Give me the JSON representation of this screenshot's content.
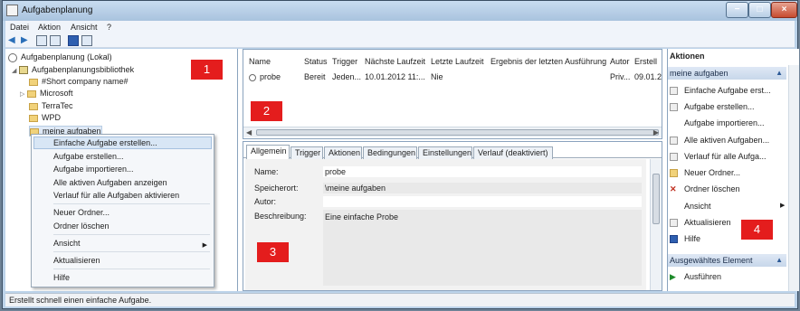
{
  "window": {
    "title": "Aufgabenplanung"
  },
  "menu": [
    "Datei",
    "Aktion",
    "Ansicht",
    "?"
  ],
  "tree": {
    "root": "Aufgabenplanung (Lokal)",
    "library": "Aufgabenplanungsbibliothek",
    "folders": [
      "#Short company name#",
      "Microsoft",
      "TerraTec",
      "WPD",
      "meine aufgaben"
    ]
  },
  "context_menu": {
    "items": [
      "Einfache Aufgabe erstellen...",
      "Aufgabe erstellen...",
      "Aufgabe importieren...",
      "Alle aktiven Aufgaben anzeigen",
      "Verlauf für alle Aufgaben aktivieren",
      "Neuer Ordner...",
      "Ordner löschen",
      "Ansicht",
      "Aktualisieren",
      "Hilfe"
    ]
  },
  "task_table": {
    "headers": [
      "Name",
      "Status",
      "Trigger",
      "Nächste Laufzeit",
      "Letzte Laufzeit",
      "Ergebnis der letzten Ausführung",
      "Autor",
      "Erstell"
    ],
    "row": [
      "probe",
      "Bereit",
      "Jeden...",
      "10.01.2012 11:...",
      "Nie",
      "",
      "Priv...",
      "09.01.2"
    ]
  },
  "detail_tabs": [
    "Allgemein",
    "Trigger",
    "Aktionen",
    "Bedingungen",
    "Einstellungen",
    "Verlauf (deaktiviert)"
  ],
  "details": {
    "name_label": "Name:",
    "name_value": "probe",
    "location_label": "Speicherort:",
    "location_value": "\\meine aufgaben",
    "author_label": "Autor:",
    "author_value": "",
    "description_label": "Beschreibung:",
    "description_value": "Eine einfache Probe"
  },
  "actions": {
    "header": "Aktionen",
    "section1": "meine aufgaben",
    "section1_items": [
      "Einfache Aufgabe erst...",
      "Aufgabe erstellen...",
      "Aufgabe importieren...",
      "Alle aktiven Aufgaben...",
      "Verlauf für alle Aufga...",
      "Neuer Ordner...",
      "Ordner löschen",
      "Ansicht",
      "Aktualisieren",
      "Hilfe"
    ],
    "section2": "Ausgewähltes Element",
    "section2_items": [
      "Ausführen"
    ]
  },
  "status": "Erstellt schnell einen einfache Aufgabe.",
  "markers": [
    "1",
    "2",
    "3",
    "4"
  ]
}
